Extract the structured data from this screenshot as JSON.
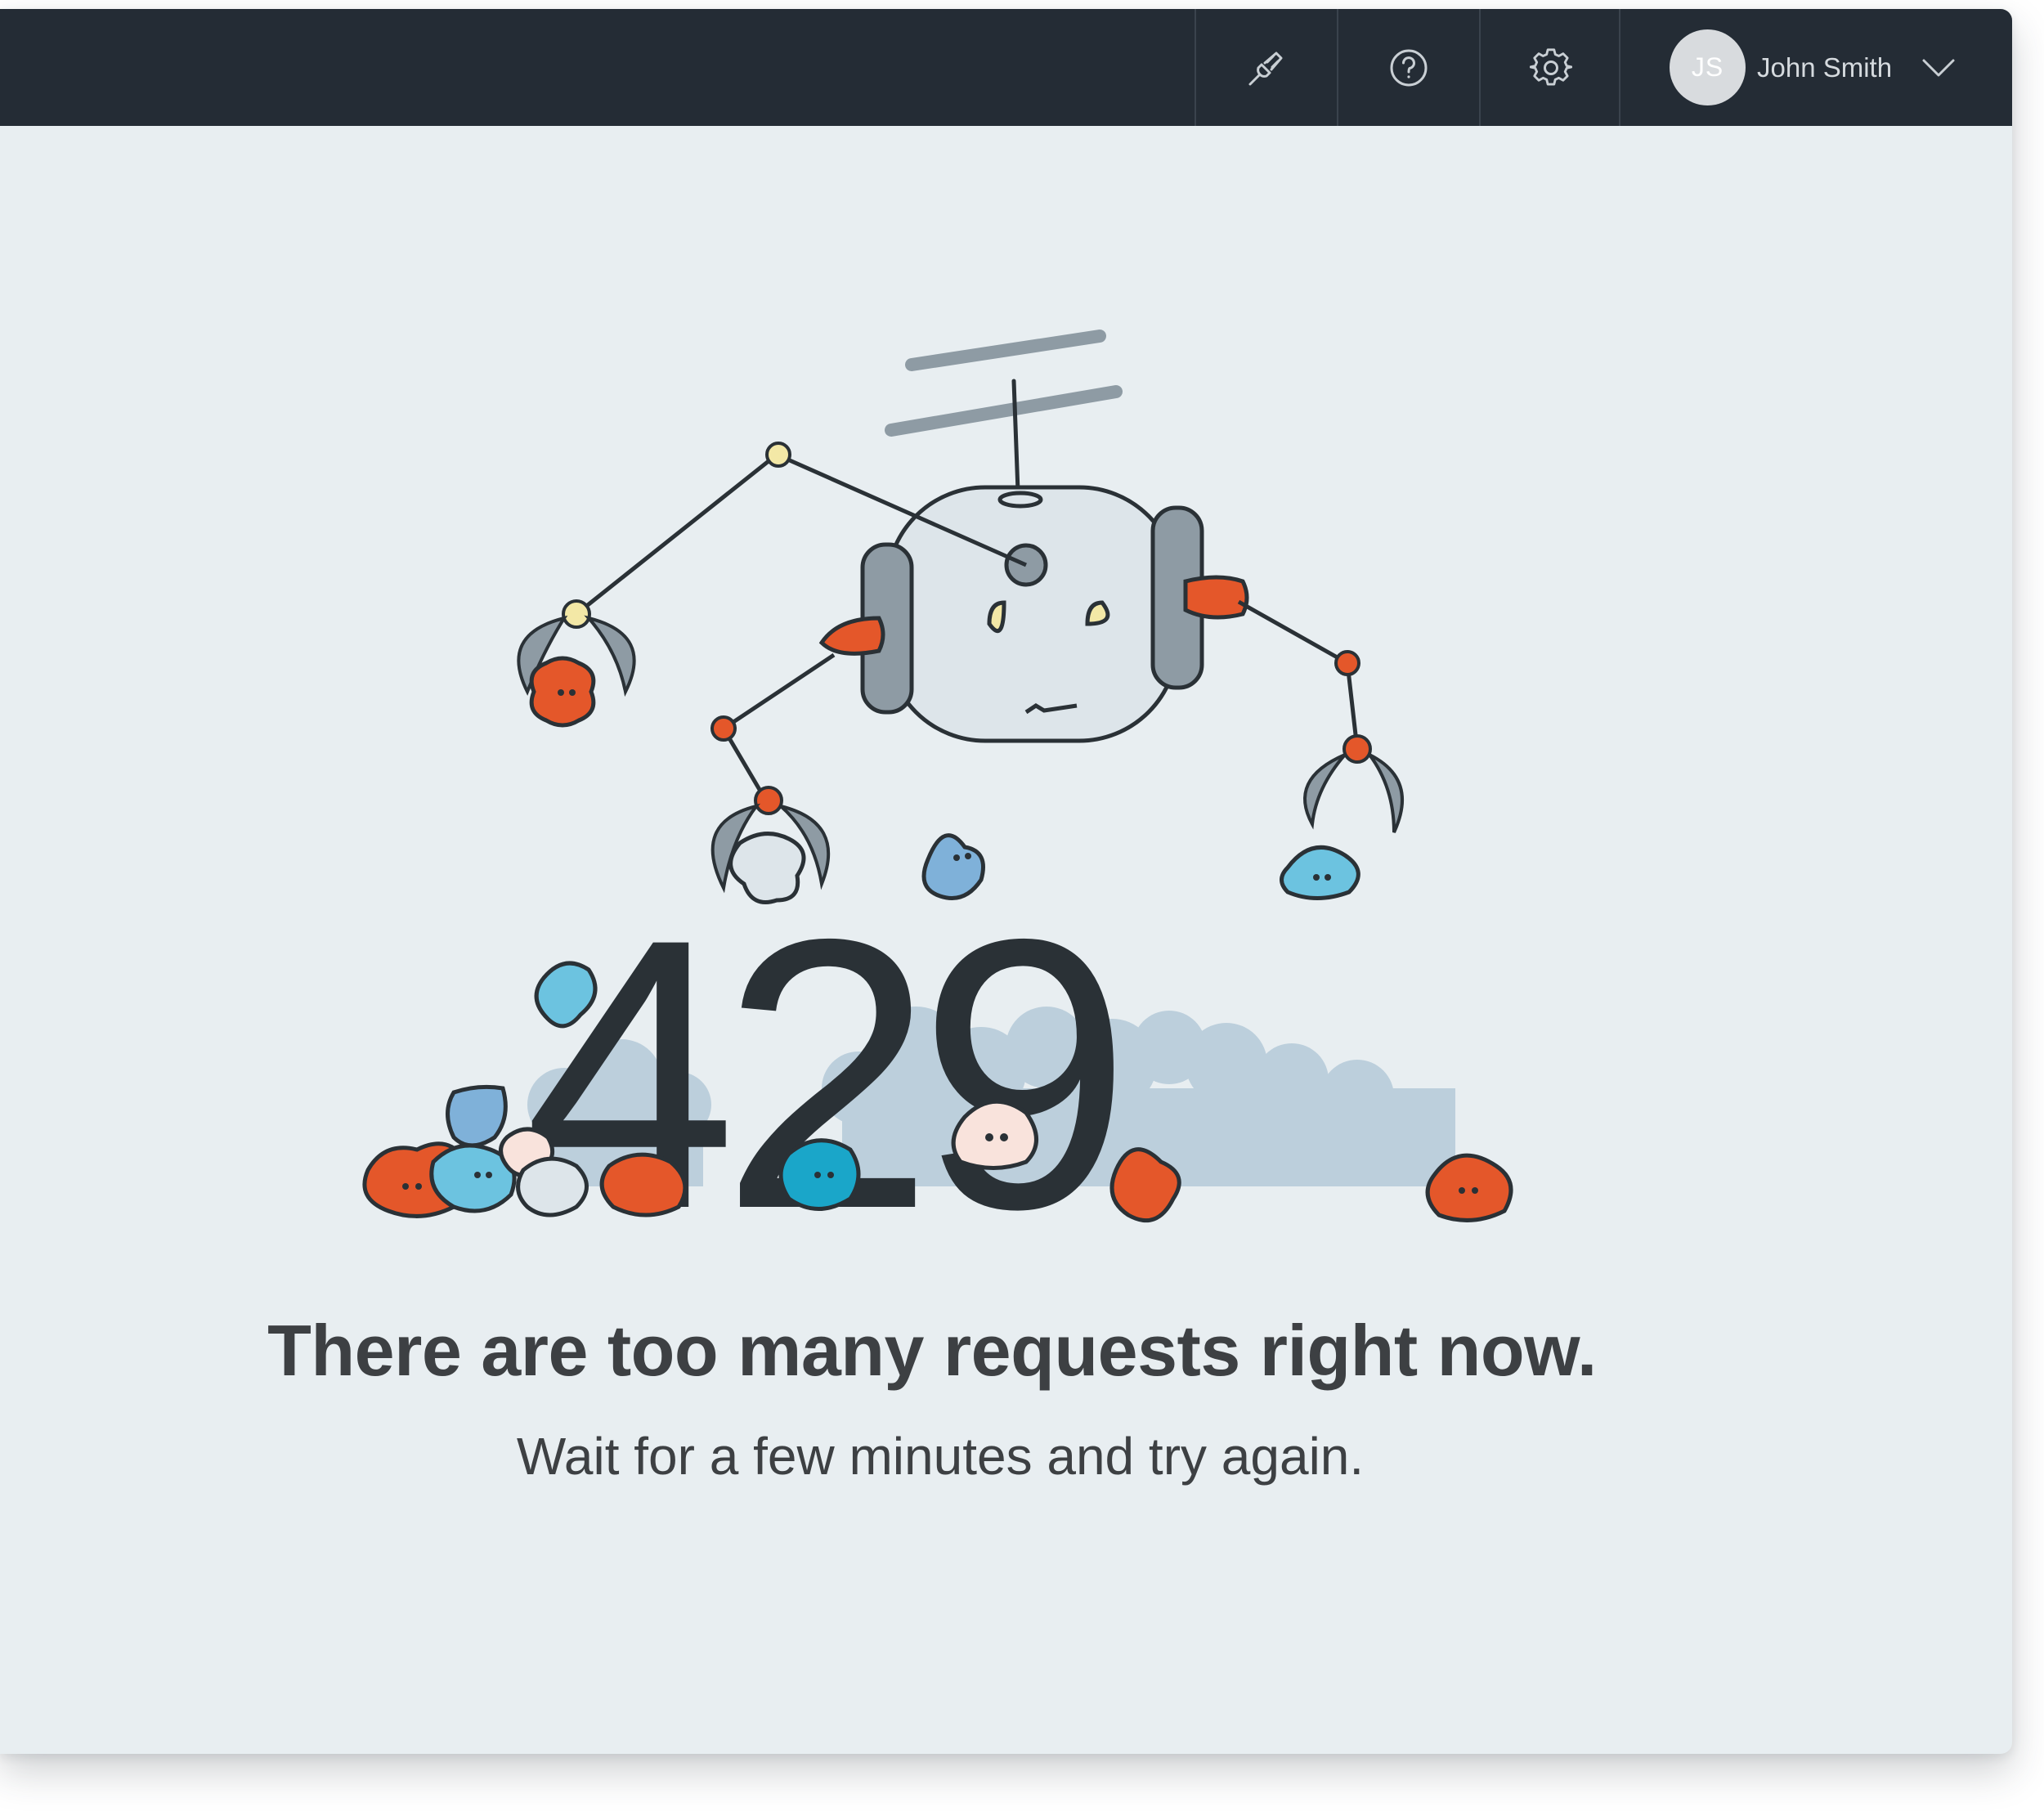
{
  "topbar": {
    "icons": {
      "integrations": "plug-icon",
      "help": "question-circle-icon",
      "settings": "gear-icon"
    },
    "user": {
      "initials": "JS",
      "name": "John Smith"
    }
  },
  "error": {
    "code": "429",
    "title": "There are too many requests right now.",
    "message": "Wait for a few minutes and try again."
  },
  "colors": {
    "topbar_bg": "#242c35",
    "page_bg": "#e8eef1",
    "digits": "#2a3136",
    "accent_orange": "#e4572a",
    "accent_blue": "#6cc3e0"
  }
}
